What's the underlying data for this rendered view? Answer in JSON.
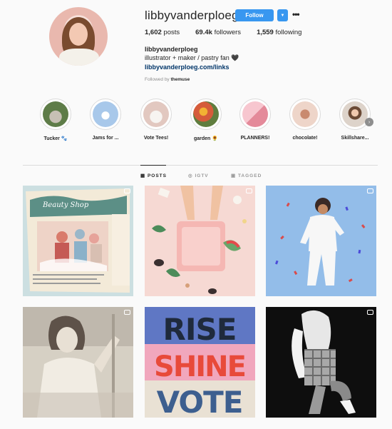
{
  "profile": {
    "username": "libbyvanderploeg",
    "follow_label": "Follow",
    "dropdown_icon": "chevron-down-icon",
    "more_label": "•••",
    "stats": {
      "posts": "1,602",
      "posts_label": "posts",
      "followers": "69.4k",
      "followers_label": "followers",
      "following": "1,559",
      "following_label": "following"
    },
    "full_name": "libbyvanderploeg",
    "bio": "illustrator + maker / pastry fan 🖤",
    "link": "libbyvanderploeg.com/links",
    "followed_by_prefix": "Followed by",
    "followed_by_user": "themuse"
  },
  "highlights": [
    {
      "label": "Tucker 🐾",
      "color": "#6d8a5a"
    },
    {
      "label": "Jams for ...",
      "color": "#a8c8ea"
    },
    {
      "label": "Vote Tees!",
      "color": "#e9d9d2"
    },
    {
      "label": "garden 🌻",
      "color": "#d55b3a"
    },
    {
      "label": "PLANNERS!",
      "color": "#f1a9b6"
    },
    {
      "label": "chocolate!",
      "color": "#e8c7b9"
    },
    {
      "label": "Skillshare...",
      "color": "#d9cfc6"
    }
  ],
  "tabs": {
    "posts": "▦  POSTS",
    "igtv": "◎  IGTV",
    "tagged": "▣  TAGGED"
  },
  "posts": {
    "p5_line1": "RISE",
    "p5_line2": "SHINE",
    "p5_line3": "VOTE"
  },
  "colors": {
    "accent": "#3897f0",
    "link": "#003569",
    "muted": "#8e8e8e"
  }
}
